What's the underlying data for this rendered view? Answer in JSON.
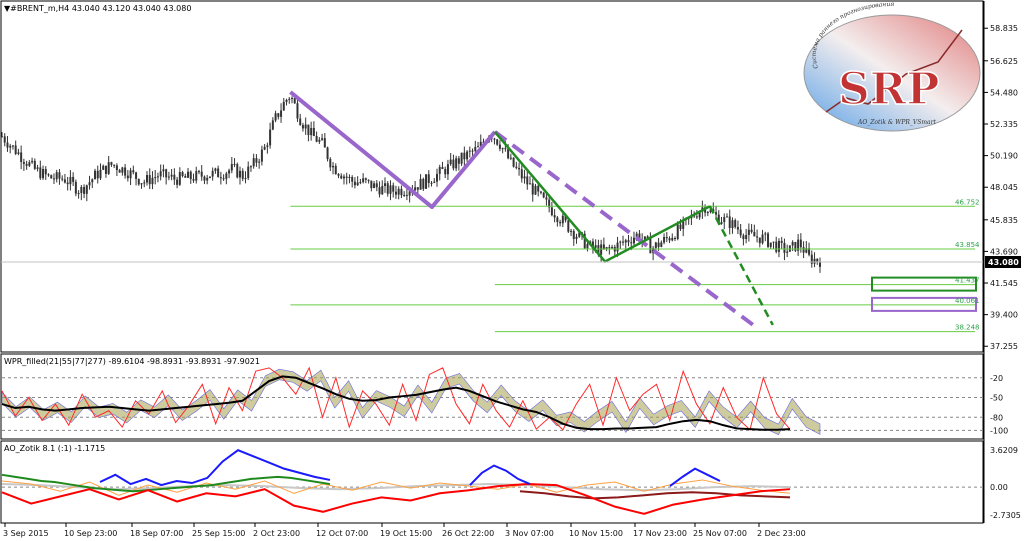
{
  "window": {
    "main_header": "▼#BRENT_m,H4  43.040 43.120 43.040 43.080",
    "wpr_header": "WPR_filled(21|55|77|277)  -89.6104 -98.8931 -93.8931 -97.9021",
    "ao_header": "AO_Zotik 8.1 (:1)  -1.1715",
    "current_price": "43.080"
  },
  "logo": {
    "letters": "SRP",
    "arc_text": "Система раннего прогнозирования",
    "footer_text": "AO_Zotik & WPR_VSmart"
  },
  "colors": {
    "candles": "#333333",
    "purple": "#9966cc",
    "green": "#228b22",
    "level": "#66cc44",
    "wpr_black": "#000000",
    "wpr_red": "#ff2a2a",
    "wpr_olive": "#a5a24e",
    "ao_blue": "#1a1aff",
    "ao_red": "#ff0000",
    "ao_green": "#1e8a1e",
    "ao_orange": "#ffa040",
    "ao_maroon": "#8b1a1a",
    "ao_gray": "#c8c8c8"
  },
  "chart_data": [
    {
      "type": "candlestick",
      "symbol": "#BRENT_m",
      "timeframe": "H4",
      "ohlc_last": {
        "open": 43.04,
        "high": 43.12,
        "low": 43.04,
        "close": 43.08
      },
      "ylim": [
        37.0,
        59.8
      ],
      "y_ticks": [
        "58.835",
        "56.625",
        "54.480",
        "52.335",
        "50.190",
        "48.045",
        "45.835",
        "43.690",
        "41.545",
        "39.400",
        "37.255"
      ],
      "x_ticks": [
        "3 Sep 2015",
        "10 Sep 23:00",
        "18 Sep 07:00",
        "25 Sep 15:00",
        "2 Oct 23:00",
        "12 Oct 07:00",
        "19 Oct 15:00",
        "26 Oct 22:00",
        "3 Nov 07:00",
        "10 Nov 15:00",
        "17 Nov 23:00",
        "25 Nov 07:00",
        "2 Dec 23:00"
      ],
      "close_path": [
        [
          0,
          51.5
        ],
        [
          0.03,
          50.4
        ],
        [
          0.06,
          49.3
        ],
        [
          0.09,
          48.7
        ],
        [
          0.12,
          48.6
        ],
        [
          0.15,
          47.8
        ],
        [
          0.18,
          48.9
        ],
        [
          0.21,
          49.6
        ],
        [
          0.24,
          49.1
        ],
        [
          0.27,
          48.4
        ],
        [
          0.3,
          48.9
        ],
        [
          0.33,
          48.6
        ],
        [
          0.36,
          48.7
        ],
        [
          0.39,
          48.9
        ],
        [
          0.42,
          49.0
        ],
        [
          0.44,
          49.3
        ],
        [
          0.46,
          48.8
        ],
        [
          0.48,
          49.6
        ],
        [
          0.5,
          50.6
        ],
        [
          0.52,
          52.6
        ],
        [
          0.54,
          53.9
        ],
        [
          0.55,
          54.3
        ],
        [
          0.57,
          52.6
        ],
        [
          0.59,
          51.6
        ],
        [
          0.61,
          51.0
        ],
        [
          0.63,
          49.5
        ],
        [
          0.65,
          48.9
        ],
        [
          0.67,
          48.4
        ],
        [
          0.69,
          48.4
        ],
        [
          0.71,
          48.1
        ],
        [
          0.74,
          47.8
        ],
        [
          0.77,
          47.9
        ],
        [
          0.8,
          48.3
        ],
        [
          0.83,
          48.9
        ],
        [
          0.86,
          49.6
        ],
        [
          0.89,
          50.3
        ],
        [
          0.91,
          50.7
        ],
        [
          0.93,
          51.8
        ],
        [
          0.95,
          51.0
        ],
        [
          0.97,
          49.7
        ],
        [
          1.0,
          48.4
        ],
        [
          1.03,
          47.2
        ],
        [
          1.06,
          46.1
        ],
        [
          1.09,
          45.0
        ],
        [
          1.12,
          44.0
        ],
        [
          1.15,
          43.7
        ],
        [
          1.18,
          44.2
        ],
        [
          1.21,
          44.8
        ],
        [
          1.24,
          43.9
        ],
        [
          1.27,
          44.6
        ],
        [
          1.3,
          45.4
        ],
        [
          1.32,
          46.2
        ],
        [
          1.34,
          46.8
        ],
        [
          1.36,
          46.1
        ],
        [
          1.39,
          45.6
        ],
        [
          1.42,
          44.8
        ],
        [
          1.45,
          44.6
        ],
        [
          1.48,
          44.0
        ],
        [
          1.5,
          43.7
        ],
        [
          1.52,
          44.3
        ],
        [
          1.54,
          43.2
        ],
        [
          1.56,
          43.08
        ]
      ],
      "purple_zigzag": [
        [
          0.55,
          54.5
        ],
        [
          0.82,
          46.7
        ],
        [
          0.94,
          51.8
        ]
      ],
      "purple_projection": [
        [
          0.94,
          51.8
        ],
        [
          1.44,
          38.5
        ]
      ],
      "green_zigzag": [
        [
          0.94,
          51.8
        ],
        [
          1.15,
          43.0
        ],
        [
          1.35,
          46.75
        ]
      ],
      "green_projection": [
        [
          1.35,
          46.75
        ],
        [
          1.47,
          38.7
        ]
      ],
      "levels": [
        "46.752",
        "43.854",
        "41.437",
        "40.061",
        "38.248"
      ],
      "level_values": [
        46.752,
        43.854,
        41.437,
        40.061,
        38.248
      ],
      "boxed_levels": [
        "41.437",
        "40.061"
      ]
    },
    {
      "type": "line",
      "name": "WPR_filled(21|55|77|277)",
      "ylim": [
        -110,
        10
      ],
      "y_ticks": [
        "-20",
        "-50",
        "-80",
        "-100"
      ],
      "series_values": {
        "black": [
          -60,
          -66,
          -64,
          -68,
          -70,
          -68,
          -66,
          -65,
          -64,
          -66,
          -68,
          -70,
          -68,
          -66,
          -64,
          -62,
          -60,
          -58,
          -55,
          -40,
          -25,
          -18,
          -20,
          -28,
          -36,
          -45,
          -52,
          -55,
          -54,
          -50,
          -48,
          -46,
          -42,
          -38,
          -35,
          -40,
          -48,
          -56,
          -62,
          -68,
          -72,
          -80,
          -90,
          -96,
          -98,
          -98,
          -97,
          -97,
          -96,
          -95,
          -90,
          -86,
          -84,
          -86,
          -92,
          -97,
          -98,
          -99,
          -99,
          -98
        ],
        "red": [
          -40,
          -78,
          -50,
          -85,
          -60,
          -92,
          -45,
          -80,
          -70,
          -95,
          -55,
          -75,
          -40,
          -88,
          -62,
          -30,
          -90,
          -35,
          -70,
          -10,
          -5,
          -20,
          -45,
          -5,
          -80,
          -20,
          -95,
          -40,
          -60,
          -92,
          -30,
          -85,
          -15,
          -5,
          -60,
          -90,
          -30,
          -70,
          -95,
          -55,
          -98,
          -80,
          -99,
          -60,
          -30,
          -92,
          -20,
          -70,
          -45,
          -30,
          -85,
          -10,
          -60,
          -90,
          -35,
          -80,
          -99,
          -20,
          -75,
          -98
        ]
      }
    },
    {
      "type": "line",
      "name": "AO_Zotik 8.1 (:1)",
      "ylim": [
        -3.2,
        4.2
      ],
      "y_ticks": [
        "3.6209",
        "0.00",
        "-2.7305"
      ],
      "series_values": {
        "green": [
          1.2,
          1.0,
          0.8,
          0.6,
          0.5,
          0.3,
          0.1,
          -0.1,
          -0.2,
          -0.3,
          -0.4,
          -0.3,
          -0.2,
          -0.1,
          0.0,
          0.1,
          0.2,
          0.4,
          0.6,
          0.8,
          0.9,
          1.0,
          0.9,
          0.7,
          0.5,
          0.3
        ],
        "blue": [
          0.5,
          1.2,
          0.3,
          0.8,
          0.2,
          0.6,
          0.4,
          0.9,
          2.5,
          3.6,
          3.0,
          2.4,
          1.8,
          1.4,
          1.0,
          0.7
        ],
        "red": [
          -0.5,
          -1.6,
          -0.9,
          -0.2,
          -1.2,
          -0.3,
          -1.4,
          -0.6,
          -0.9,
          -0.2,
          -1.8,
          -2.4,
          -1.6,
          -1.0,
          -1.3,
          -0.6,
          -0.3,
          0.1,
          0.3,
          0.2,
          -0.8,
          -1.9,
          -2.6,
          -1.7,
          -1.2,
          -0.8,
          -0.4,
          -0.2
        ],
        "blue2": [
          0.2,
          1.4,
          2.1,
          1.6,
          0.8,
          0.3
        ],
        "blue3": [
          0.1,
          1.0,
          1.8,
          1.2,
          0.6
        ],
        "maroon": [
          -0.4,
          -0.6,
          -0.9,
          -1.1,
          -1.0,
          -0.8,
          -0.6,
          -0.5,
          -0.6,
          -0.8,
          -0.9,
          -1.0
        ],
        "orange": [
          0.6,
          0.3,
          -0.4,
          0.5,
          -0.8,
          0.2,
          -0.5,
          0.4,
          -0.2,
          0.6,
          -0.6,
          0.3,
          -0.3,
          0.5,
          -0.1,
          0.4,
          0.1,
          -0.2,
          0.3,
          -0.5,
          0.2,
          0.5,
          -0.4,
          0.3,
          0.7,
          0.1,
          -0.3,
          -0.6
        ],
        "gray": [
          0.3,
          0.2,
          0.0,
          -0.2,
          -0.1,
          0.1,
          0.2,
          0.1,
          -0.1,
          -0.2,
          -0.1,
          0.1,
          0.2,
          0.3,
          0.2,
          0.0,
          -0.2,
          -0.3,
          -0.2,
          0.0,
          0.1,
          0.0
        ]
      }
    }
  ]
}
